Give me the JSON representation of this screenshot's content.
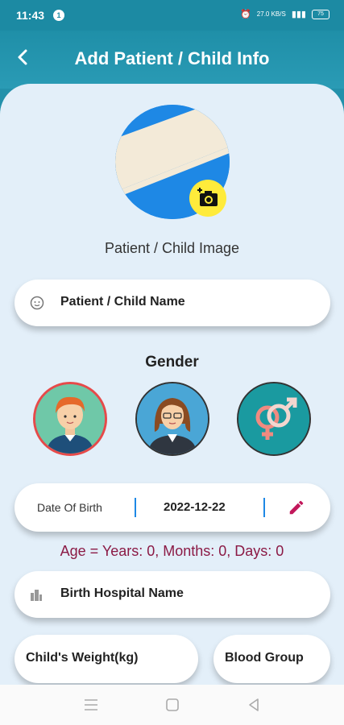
{
  "status": {
    "time": "11:43",
    "notif": "1",
    "battery": "75",
    "net": "27.0 KB/S"
  },
  "appbar": {
    "title": "Add Patient / Child Info"
  },
  "photo": {
    "label": "Patient / Child Image"
  },
  "name_field": {
    "placeholder": "Patient / Child Name"
  },
  "gender": {
    "title": "Gender",
    "options": [
      "male",
      "female",
      "other"
    ]
  },
  "dob": {
    "label": "Date Of Birth",
    "value": "2022-12-22"
  },
  "age": {
    "text": "Age = Years: 0, Months: 0, Days: 0"
  },
  "hospital_field": {
    "placeholder": "Birth Hospital Name"
  },
  "weight_field": {
    "placeholder": "Child's Weight(kg)"
  },
  "blood_field": {
    "placeholder": "Blood Group"
  },
  "colors": {
    "primary": "#2391ab",
    "accent": "#8b1a45",
    "background": "#e3eff9",
    "camera": "#ffeb3b"
  }
}
